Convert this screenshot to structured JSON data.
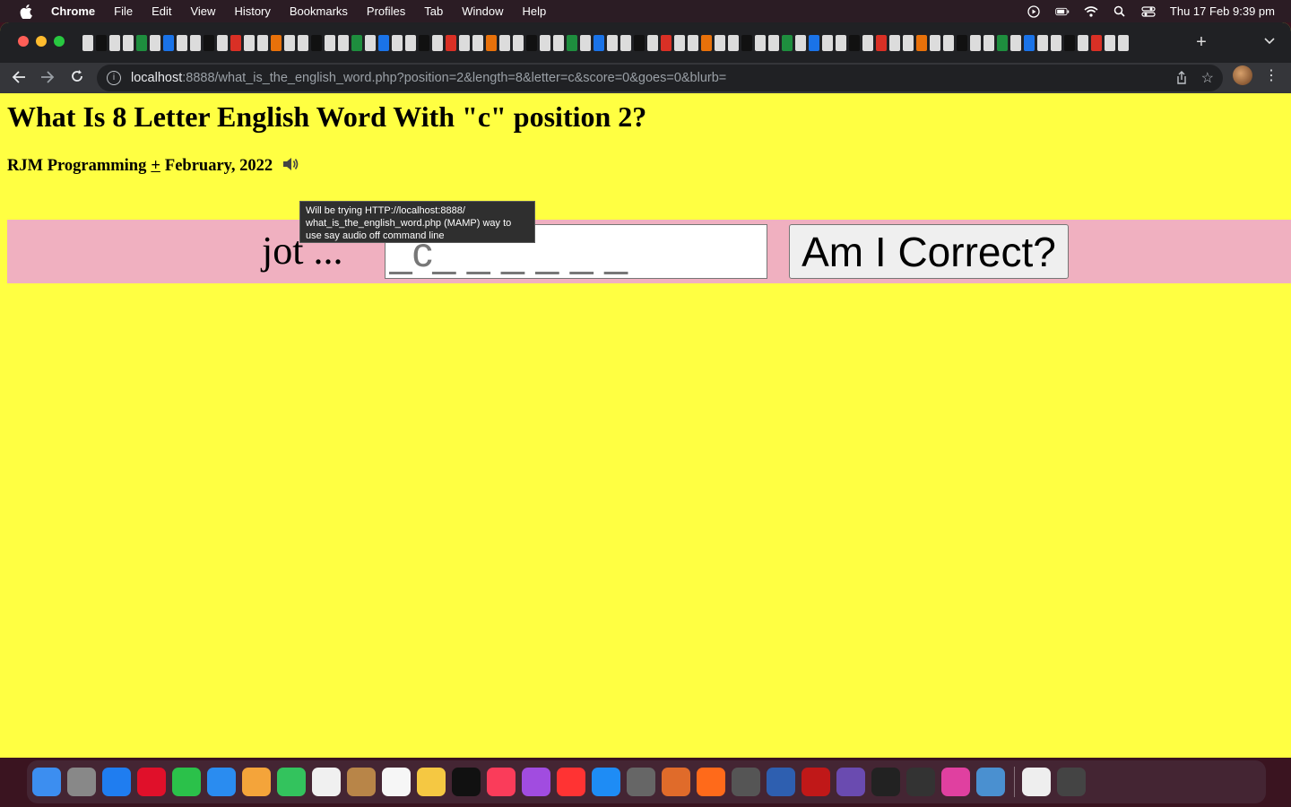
{
  "menubar": {
    "app_name": "Chrome",
    "items": [
      "File",
      "Edit",
      "View",
      "History",
      "Bookmarks",
      "Profiles",
      "Tab",
      "Window",
      "Help"
    ],
    "clock": "Thu 17 Feb  9:39 pm"
  },
  "browser": {
    "url_host": "localhost",
    "url_rest": ":8888/what_is_the_english_word.php?position=2&length=8&letter=c&score=0&goes=0&blurb=",
    "new_tab_glyph": "+",
    "tab_count": 78
  },
  "page": {
    "title": "What Is 8 Letter English Word With \"c\" position 2?",
    "byline_author": "RJM Programming",
    "byline_plus": "+",
    "byline_date": "February, 2022",
    "speaker_icon": "speaker-icon",
    "prompt_text": "jot ...",
    "answer_placeholder": "_c_ _ _ _ _ _",
    "answer_value": "",
    "button_label": "Am I Correct?",
    "tooltip": "Will be trying HTTP://localhost:8888/ what_is_the_english_word.php (MAMP) way to use say audio off command line"
  },
  "colors": {
    "page_background": "#ffff42",
    "band_background": "#f0b0c0"
  }
}
